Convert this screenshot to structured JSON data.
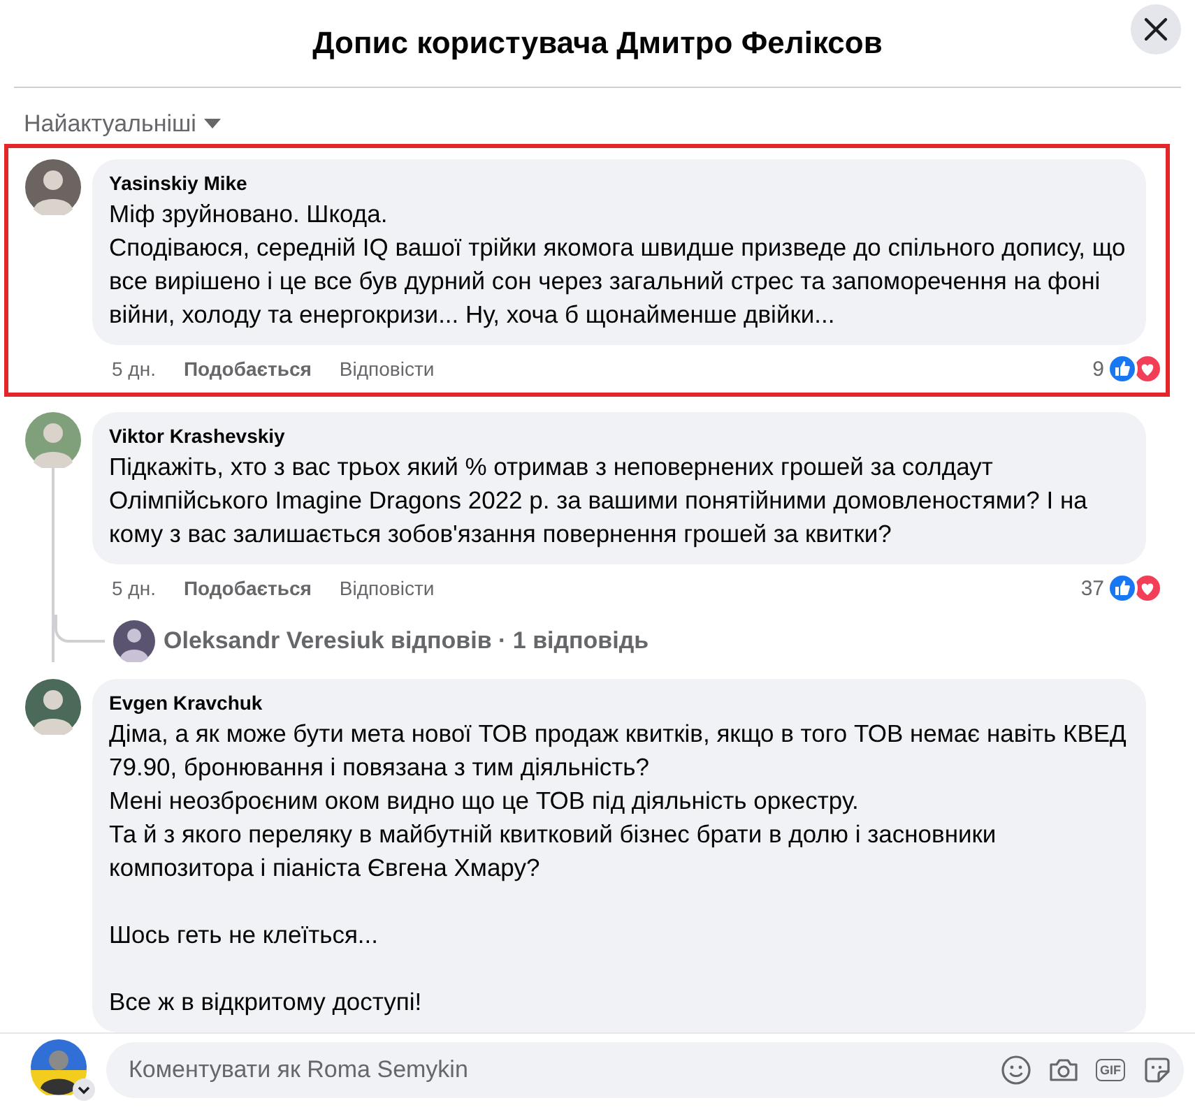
{
  "header": {
    "title": "Допис користувача Дмитро Феліксов"
  },
  "sort": {
    "label": "Найактуальніші"
  },
  "comments": [
    {
      "author": "Yasinskiy Mike",
      "highlighted": true,
      "paragraphs": [
        [
          "Міф зруйновано. Шкода.",
          "Сподіваюся, середній IQ вашої трійки якомога швидше призведе до спільного допису, що все вирішено і це все був дурний сон через загальний стрес та запоморечення на фоні війни, холоду та енергокризи... Ну, хоча б щонайменше двійки..."
        ]
      ],
      "time": "5 дн.",
      "like_label": "Подобається",
      "reply_label": "Відповісти",
      "reaction_count": "9"
    },
    {
      "author": "Viktor Krashevskiy",
      "highlighted": false,
      "paragraphs": [
        [
          "Підкажіть, хто з вас трьох який % отримав з неповернених грошей за солдаут Олімпійського Imagine Dragons 2022 р. за вашими понятійними домовленостями? І на кому з вас залишається зобов'язання повернення грошей за квитки?"
        ]
      ],
      "time": "5 дн.",
      "like_label": "Подобається",
      "reply_label": "Відповісти",
      "reaction_count": "37",
      "replies_summary": "Oleksandr Veresiuk відповів · 1 відповідь"
    },
    {
      "author": "Evgen Kravchuk",
      "highlighted": false,
      "paragraphs": [
        [
          "Діма, а як може бути мета нової ТОВ продаж квитків, якщо в того ТОВ немає навіть КВЕД 79.90, бронювання і повязана з тим діяльність?",
          "Мені неозброєним оком видно що це ТОВ під діяльність оркестру.",
          "Та й з якого переляку в майбутній квитковий бізнес брати в долю і засновники композитора і піаніста Євгена Хмару?"
        ],
        [
          "Шось геть не клеїться..."
        ],
        [
          "Все ж в відкритому доступі!"
        ]
      ]
    }
  ],
  "composer": {
    "placeholder": "Коментувати як Roma Semykin",
    "gif_label": "GIF"
  }
}
